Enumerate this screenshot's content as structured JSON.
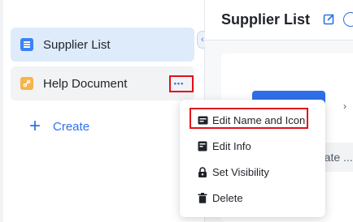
{
  "sidebar": {
    "items": [
      {
        "label": "Supplier List",
        "icon": "table-icon",
        "color": "#3b82f6"
      },
      {
        "label": "Help Document",
        "icon": "link-icon",
        "color": "#f6b44a"
      }
    ],
    "more_label": "•••",
    "create_icon": "+",
    "create_label": "Create",
    "collapse_icon": "‹"
  },
  "main": {
    "title": "Supplier List",
    "card_text": "rate ..."
  },
  "menu": {
    "items": [
      {
        "label": "Edit Name and Icon",
        "icon": "form-icon"
      },
      {
        "label": "Edit Info",
        "icon": "note-edit-icon"
      },
      {
        "label": "Set Visibility",
        "icon": "lock-icon"
      },
      {
        "label": "Delete",
        "icon": "trash-icon"
      }
    ]
  },
  "colors": {
    "accent": "#2f6fe8",
    "highlight": "#e1111b",
    "active_bg": "#deebfb"
  }
}
